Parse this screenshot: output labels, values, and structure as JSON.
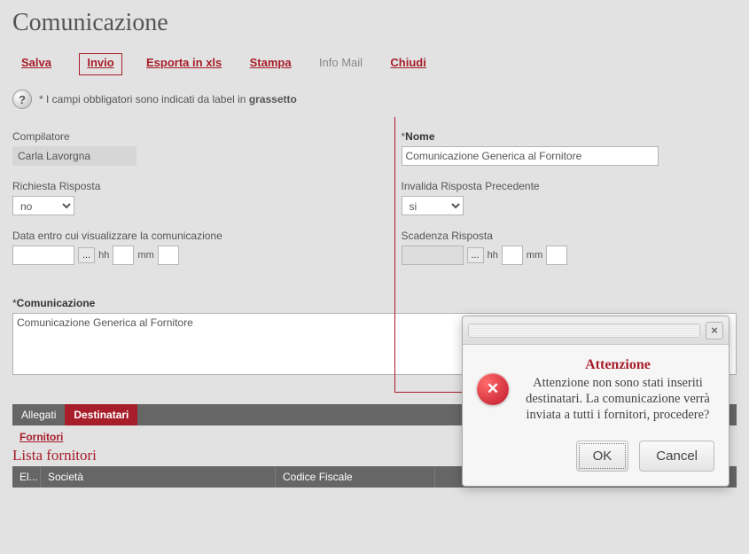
{
  "page": {
    "title": "Comunicazione"
  },
  "toolbar": {
    "salva": "Salva",
    "invio": "Invio",
    "esporta": "Esporta in xls",
    "stampa": "Stampa",
    "info_mail": "Info Mail",
    "chiudi": "Chiudi"
  },
  "help": {
    "prefix": "* I campi obbligatori sono indicati da label in ",
    "bold_word": "grassetto"
  },
  "form": {
    "compilatore": {
      "label": "Compilatore",
      "value": "Carla Lavorgna"
    },
    "nome": {
      "label": "Nome",
      "value": "Comunicazione Generica al Fornitore"
    },
    "richiesta_risposta": {
      "label": "Richiesta Risposta",
      "value": "no"
    },
    "invalida": {
      "label": "Invalida Risposta Precedente",
      "value": "si"
    },
    "data_visual": {
      "label": "Data entro cui visualizzare la comunicazione",
      "hh": "hh",
      "mm": "mm"
    },
    "scadenza": {
      "label": "Scadenza Risposta",
      "hh": "hh",
      "mm": "mm"
    },
    "comunicazione": {
      "label": "Comunicazione",
      "value": "Comunicazione Generica al Fornitore"
    }
  },
  "tabs": {
    "allegati": "Allegati",
    "destinatari": "Destinatari"
  },
  "sublink": {
    "fornitori": "Fornitori"
  },
  "list": {
    "title": "Lista fornitori",
    "col1": "El...",
    "col2": "Società",
    "col3": "Codice Fiscale",
    "col4": ""
  },
  "dialog": {
    "heading": "Attenzione",
    "message": "Attenzione non sono stati inseriti destinatari. La comunicazione verrà inviata a tutti i fornitori, procedere?",
    "ok": "OK",
    "cancel": "Cancel"
  }
}
